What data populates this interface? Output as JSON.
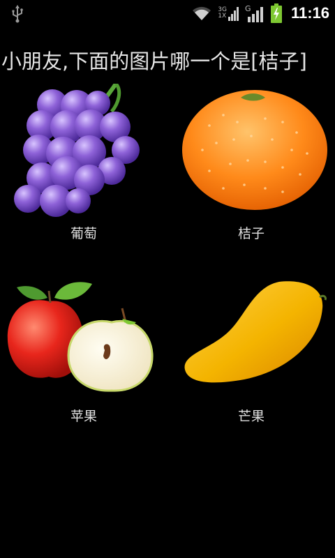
{
  "status_bar": {
    "time": "11:16",
    "network_top": "3G",
    "network_bottom": "1X",
    "network_g": "G",
    "icons": [
      "usb-icon",
      "wifi-icon",
      "signal-3g-icon",
      "signal-g-icon",
      "battery-charging-icon"
    ]
  },
  "question": "小朋友,下面的图片哪一个是[桔子]",
  "fruits": [
    {
      "label": "葡萄",
      "icon": "grapes-icon"
    },
    {
      "label": "桔子",
      "icon": "orange-icon"
    },
    {
      "label": "苹果",
      "icon": "apple-icon"
    },
    {
      "label": "芒果",
      "icon": "mango-icon"
    }
  ],
  "colors": {
    "background": "#000000",
    "grape": "#8a5fd0",
    "orange": "#ff8a1a",
    "apple": "#e8261c",
    "mango": "#f4b400",
    "battery": "#7ec832"
  }
}
